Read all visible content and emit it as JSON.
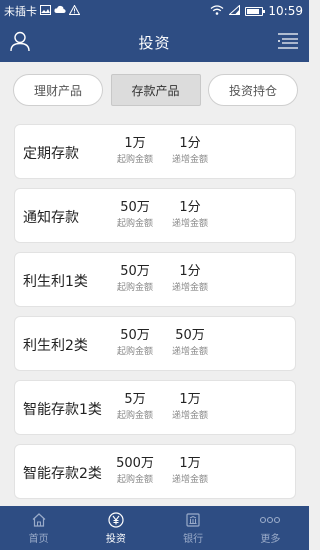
{
  "status_bar": {
    "carrier": "未插卡",
    "time": "10:59",
    "battery_level": 0.85
  },
  "header": {
    "title": "投资",
    "left_icon": "user-icon",
    "right_icon": "menu-list-icon"
  },
  "tabs": [
    {
      "label": "理财产品",
      "active": false
    },
    {
      "label": "存款产品",
      "active": true
    },
    {
      "label": "投资持仓",
      "active": false
    }
  ],
  "products": [
    {
      "name": "定期存款",
      "min_amount": "1万",
      "min_label": "起购金额",
      "step_amount": "1分",
      "step_label": "递增金额"
    },
    {
      "name": "通知存款",
      "min_amount": "50万",
      "min_label": "起购金额",
      "step_amount": "1分",
      "step_label": "递增金额"
    },
    {
      "name": "利生利1类",
      "min_amount": "50万",
      "min_label": "起购金额",
      "step_amount": "1分",
      "step_label": "递增金额"
    },
    {
      "name": "利生利2类",
      "min_amount": "50万",
      "min_label": "起购金额",
      "step_amount": "50万",
      "step_label": "递增金额"
    },
    {
      "name": "智能存款1类",
      "min_amount": "5万",
      "min_label": "起购金额",
      "step_amount": "1万",
      "step_label": "递增金额"
    },
    {
      "name": "智能存款2类",
      "min_amount": "500万",
      "min_label": "起购金额",
      "step_amount": "1万",
      "step_label": "递增金额"
    }
  ],
  "bottom_nav": [
    {
      "label": "首页",
      "icon": "home-icon",
      "active": false
    },
    {
      "label": "投资",
      "icon": "yen-icon",
      "active": true
    },
    {
      "label": "银行",
      "icon": "bank-icon",
      "active": false
    },
    {
      "label": "更多",
      "icon": "more-icon",
      "active": false
    }
  ],
  "colors": {
    "primary": "#2e4d83",
    "background": "#efefef",
    "inactive_nav": "#9aabc9"
  }
}
